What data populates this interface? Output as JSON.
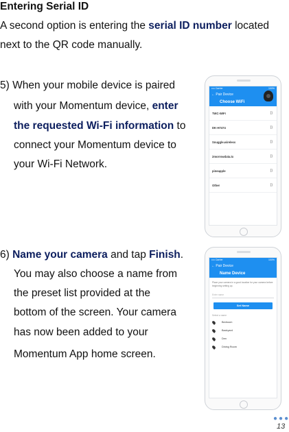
{
  "heading": "Entering Serial ID",
  "intro": {
    "l1_a": "A second option is entering the ",
    "l1_b": "serial ID number",
    "l1_c": " located",
    "l2": "next to the QR code manually."
  },
  "step5": {
    "l1": "5) When your mobile device is paired",
    "l2_a": "with your Momentum device, ",
    "l2_b": "enter",
    "l3_a": "the requested Wi-Fi information",
    "l3_b": " to",
    "l4": "connect your Momentum device to",
    "l5": "your Wi-Fi Network."
  },
  "step6": {
    "l1_a": "6) ",
    "l1_b": "Name your camera",
    "l1_c": " and tap ",
    "l1_d": "Finish",
    "l1_e": ".",
    "l2": "You may also choose a name from",
    "l3": "the preset list provided at the",
    "l4": "bottom of the screen. Your camera",
    "l5": "has now been added to your",
    "l6": "Momentum App home screen."
  },
  "phone1": {
    "status_left": "•••• Carrier",
    "status_right": "100%",
    "nav": "← Pair Device",
    "title": "Choose WiFi",
    "networks": [
      "TWC-WIFI",
      "DK-H7474",
      "Snuggle.wireless",
      "2morrowdata.tx",
      "pineapple",
      "Other"
    ],
    "wifi_icon": "wifi-icon"
  },
  "phone2": {
    "status_left": "•••• Carrier",
    "status_right": "100%",
    "nav": "← Pair Device",
    "title": "Name Device",
    "tip": "Place your camera in a good location for your camera before beginning setting up.",
    "name_placeholder": "Enter name",
    "set_button": "Set Name",
    "preset_label": "Select a name",
    "rooms": [
      "Bedroom",
      "Backyard",
      "Den",
      "Dining Room"
    ]
  },
  "page_number": "13"
}
